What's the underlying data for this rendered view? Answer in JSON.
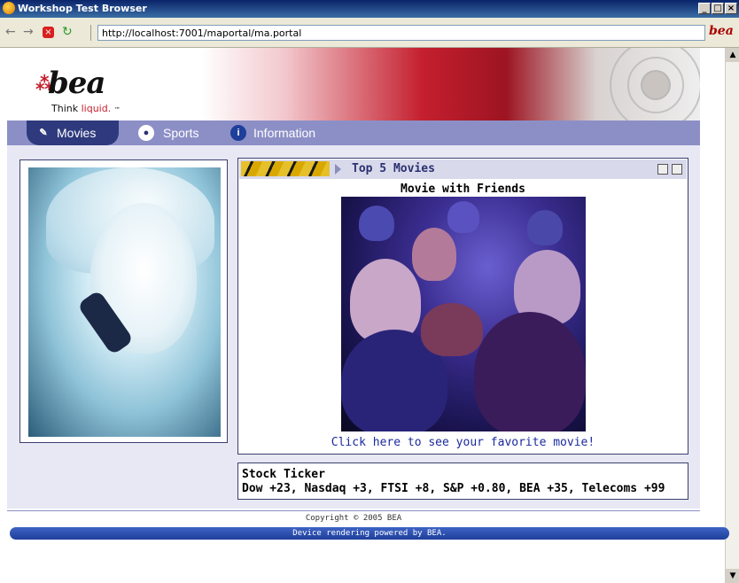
{
  "window": {
    "title": "Workshop Test Browser",
    "minimize": "_",
    "maximize": "□",
    "close": "×"
  },
  "toolbar": {
    "url": "http://localhost:7001/maportal/ma.portal",
    "brand": "bea"
  },
  "header": {
    "logo": "bea",
    "tagline_prefix": "Think",
    "tagline_accent": "liquid.",
    "tagline_tm": "™"
  },
  "nav": {
    "items": [
      {
        "label": "Movies",
        "active": true
      },
      {
        "label": "Sports",
        "active": false
      },
      {
        "label": "Information",
        "active": false
      }
    ]
  },
  "movies": {
    "portlet_title": "Top 5 Movies",
    "heading": "Movie with Friends",
    "link": "Click here to see your favorite movie!"
  },
  "ticker": {
    "title": "Stock Ticker",
    "text": "Dow +23, Nasdaq +3, FTSI +8, S&P +0.80, BEA +35, Telecoms +99"
  },
  "footer": {
    "copyright": "Copyright © 2005 BEA",
    "powered": "Device rendering powered by BEA."
  },
  "colors": {
    "nav_bg": "#8c8fc6",
    "nav_active": "#2e3a7d",
    "brand_red": "#c41f2e",
    "content_bg": "#e8e8f4"
  }
}
